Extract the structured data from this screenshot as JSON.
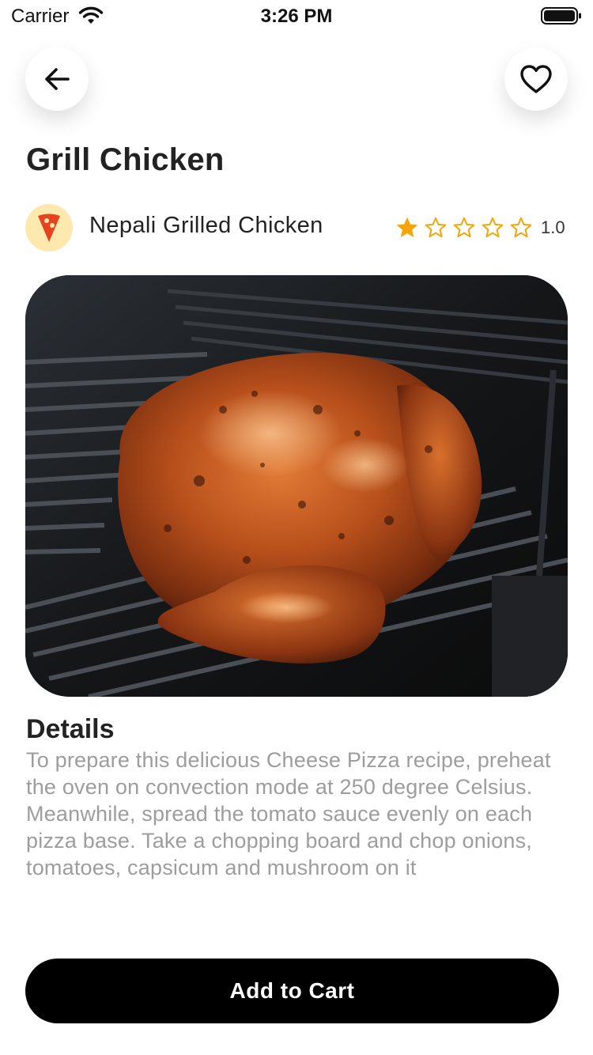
{
  "status_bar": {
    "carrier": "Carrier",
    "time": "3:26 PM"
  },
  "header": {
    "back_icon": "arrow-left-icon",
    "favorite_icon": "heart-outline-icon"
  },
  "product": {
    "title": "Grill Chicken",
    "restaurant": {
      "name": "Nepali Grilled Chicken",
      "logo_icon": "pizza-slice-icon"
    },
    "rating": {
      "value": "1.0",
      "filled_stars": 1,
      "total_stars": 5
    },
    "image_description_icon": "grilled-chicken-photo",
    "details_heading": "Details",
    "details_text": "To prepare this delicious Cheese Pizza recipe, preheat the oven on convection mode at 250 degree Celsius. Meanwhile, spread the tomato sauce evenly on each pizza base. Take a chopping board and chop onions, tomatoes, capsicum and mushroom on it"
  },
  "actions": {
    "add_to_cart_label": "Add to Cart"
  },
  "colors": {
    "star": "#F5A50A",
    "logo_bg": "#FDE9AD",
    "logo_fg": "#E5431F",
    "button_bg": "#000000",
    "details_text": "#9D9D9D"
  }
}
